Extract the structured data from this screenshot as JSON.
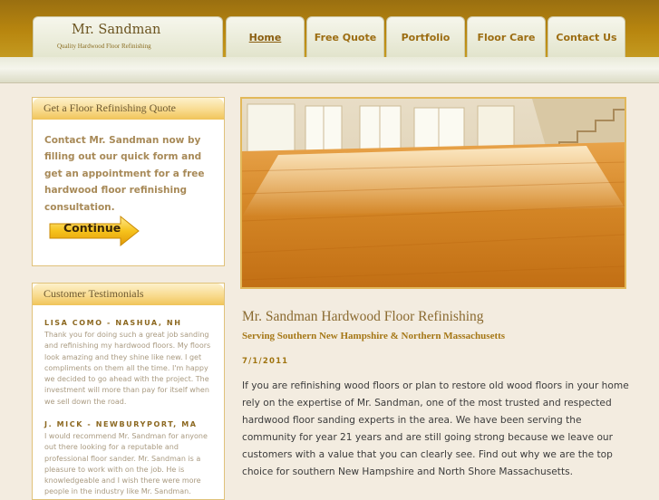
{
  "header": {
    "logo_title": "Mr. Sandman",
    "logo_tagline": "Quality Hardwood Floor Refinishing",
    "nav": [
      {
        "label": "Home"
      },
      {
        "label": "Free Quote"
      },
      {
        "label": "Portfolio"
      },
      {
        "label": "Floor Care"
      },
      {
        "label": "Contact Us"
      }
    ]
  },
  "quote_panel": {
    "title": "Get a Floor Refinishing Quote",
    "text": "Contact Mr. Sandman now by filling out our quick form and get an appointment for a free hardwood floor refinishing consultation.",
    "button_label": "Continue"
  },
  "testimonials_panel": {
    "title": "Customer Testimonials",
    "items": [
      {
        "name": "LISA COMO - NASHUA, NH",
        "text": "Thank you for doing such a great job sanding and refinishing my hardwood floors. My floors look amazing and they shine like new. I get compliments on them all the time. I'm happy we decided to go ahead with the project. The investment will more than pay for itself when we sell down the road."
      },
      {
        "name": "J. MICK - NEWBURYPORT, MA",
        "text": "I would recommend Mr. Sandman for anyone out there looking for a reputable and professional floor sander. Mr. Sandman is a pleasure to work with on the job. He is knowledgeable and I wish there were more people in the industry like Mr. Sandman."
      }
    ]
  },
  "main": {
    "title": "Mr. Sandman Hardwood Floor Refinishing",
    "subtitle": "Serving Southern New Hampshire & Northern Massachusetts",
    "date": "7/1/2011",
    "body": "If you are refinishing wood floors or plan to restore old wood floors in your home rely on the expertise of Mr. Sandman, one of the most trusted and respected hardwood floor sanding experts in the area. We have been serving the community for year 21 years and are still going strong because we leave our customers with a value that you can clearly see. Find out why we are the top choice for southern New Hampshire and North Shore Massachusetts."
  },
  "colors": {
    "header_gold": "#b8860f",
    "nav_text": "#9c6d12",
    "panel_border": "#e0c27a",
    "page_bg": "#f3ece0"
  }
}
